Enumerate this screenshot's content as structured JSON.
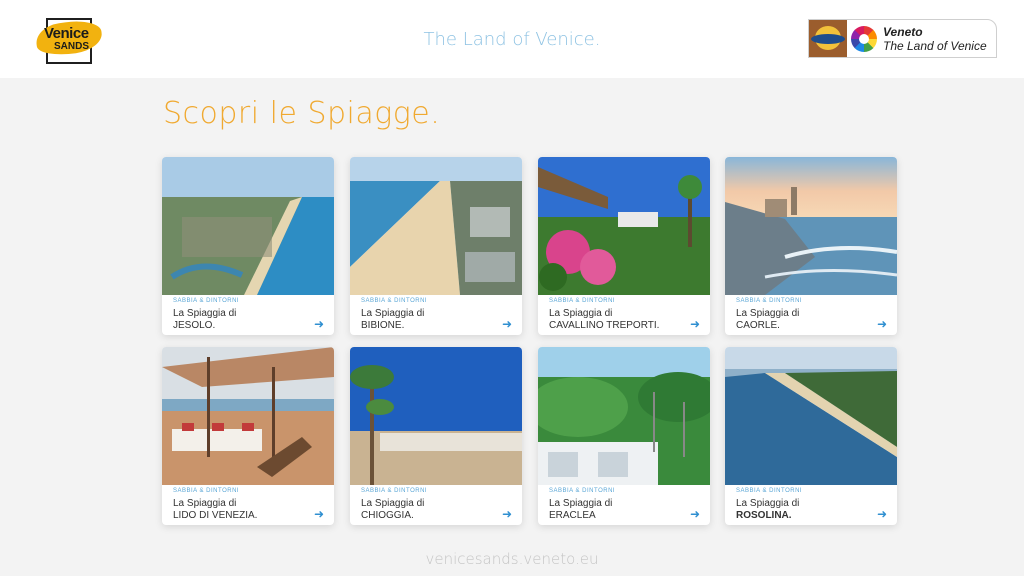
{
  "header": {
    "logo": {
      "line1": "Venice",
      "line2": "SANDS"
    },
    "tagline": "The Land of Venice.",
    "badge": {
      "line1": "Veneto",
      "line2": "The Land of Venice"
    }
  },
  "main": {
    "title": "Scopri le Spiagge.",
    "cards": [
      {
        "category": "SABBIA & DINTORNI",
        "prefix": "La Spiaggia di",
        "name": "JESOLO."
      },
      {
        "category": "SABBIA & DINTORNI",
        "prefix": "La Spiaggia di",
        "name": "BIBIONE."
      },
      {
        "category": "SABBIA & DINTORNI",
        "prefix": "La Spiaggia di",
        "name": "CAVALLINO TREPORTI."
      },
      {
        "category": "SABBIA & DINTORNI",
        "prefix": "La Spiaggia di",
        "name": "CAORLE."
      },
      {
        "category": "SABBIA & DINTORNI",
        "prefix": "La Spiaggia di",
        "name": "LIDO DI VENEZIA."
      },
      {
        "category": "SABBIA & DINTORNI",
        "prefix": "La Spiaggia di",
        "name": "CHIOGGIA."
      },
      {
        "category": "SABBIA & DINTORNI",
        "prefix": "La Spiaggia di",
        "name": "ERACLEA"
      },
      {
        "category": "SABBIA & DINTORNI",
        "prefix": "La Spiaggia di",
        "name": "ROSOLINA."
      }
    ],
    "arrow_icon": "arrow-right-icon"
  },
  "footer": {
    "url": "venicesands.veneto.eu"
  },
  "colors": {
    "accent_title": "#f0a930",
    "tagline": "#8fc3e3",
    "link_arrow": "#2f8fd0",
    "category": "#5aa6d6"
  }
}
